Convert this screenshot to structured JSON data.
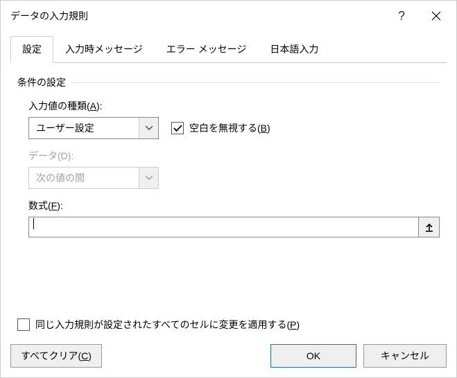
{
  "title": "データの入力規則",
  "tabs": {
    "t0": "設定",
    "t1": "入力時メッセージ",
    "t2": "エラー メッセージ",
    "t3": "日本語入力"
  },
  "group_label": "条件の設定",
  "allow": {
    "label_pre": "入力値の種類(",
    "label_key": "A",
    "label_post": "):",
    "value": "ユーザー設定"
  },
  "ignore_blank": {
    "label_pre": "空白を無視する(",
    "label_key": "B",
    "label_post": ")",
    "checked": true
  },
  "data": {
    "label_pre": "データ(",
    "label_key": "D",
    "label_post": "):",
    "value": "次の値の間",
    "enabled": false
  },
  "formula": {
    "label_pre": "数式(",
    "label_key": "F",
    "label_post": "):",
    "value": ""
  },
  "apply_all": {
    "label_pre": "同じ入力規則が設定されたすべてのセルに変更を適用する(",
    "label_key": "P",
    "label_post": ")",
    "checked": false,
    "enabled": false
  },
  "buttons": {
    "clear_pre": "すべてクリア(",
    "clear_key": "C",
    "clear_post": ")",
    "ok": "OK",
    "cancel": "キャンセル"
  }
}
